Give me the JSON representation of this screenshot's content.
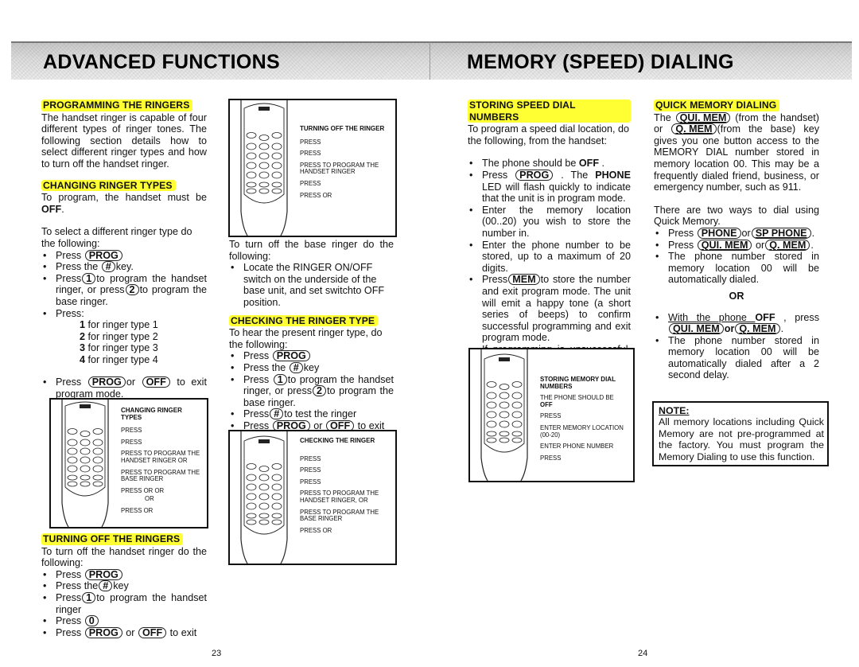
{
  "left_page": {
    "banner_title": "ADVANCED FUNCTIONS",
    "page_number": "23",
    "programming": {
      "heading": "PROGRAMMING THE RINGERS",
      "body": "The handset ringer is capable of four different types of ringer tones. The following section details how to select different ringer types and how to turn off the handset ringer."
    },
    "changing": {
      "heading": "CHANGING RINGER TYPES",
      "intro_pre": "To program, the handset must be ",
      "intro_bold": "OFF",
      "intro_post": ".",
      "select_text": "To select a different ringer type do the following:",
      "steps": {
        "s1_pre": "Press ",
        "s1_key": "PROG",
        "s2_pre": "Press the ",
        "s2_key": "#",
        "s2_post": "key.",
        "s3_pre": "Press",
        "s3_key": "1",
        "s3_mid": "to program the handset ringer, or press",
        "s3_key2": "2",
        "s3_post": "to program the base ringer.",
        "s4": "Press:",
        "s6_pre": "Press ",
        "s6_key": "PROG",
        "s6_mid": "or ",
        "s6_key2": "OFF",
        "s6_post": " to exit program mode."
      },
      "ringer_types": [
        {
          "num": "1",
          "label": " for ringer type 1"
        },
        {
          "num": "2",
          "label": " for ringer type 2"
        },
        {
          "num": "3",
          "label": " for ringer type 3"
        },
        {
          "num": "4",
          "label": " for ringer type 4"
        }
      ],
      "diagram": {
        "title": "CHANGING RINGER TYPES",
        "steps": [
          "PRESS",
          "PRESS",
          "PRESS  TO PROGRAM THE HANDSET RINGER OR",
          "PRESS  TO PROGRAM THE BASE RINGER",
          "PRESS  OR  OR",
          "OR",
          "PRESS  OR"
        ]
      }
    },
    "turning_off": {
      "heading": "TURNING OFF THE RINGERS",
      "intro": "To turn off the handset ringer do the following:",
      "s1_pre": "Press ",
      "s1_key": "PROG",
      "s2_pre": "Press the",
      "s2_key": "#",
      "s2_post": "key",
      "s3_pre": "Press",
      "s3_key": "1",
      "s3_post": "to program the handset ringer",
      "s4_pre": "Press ",
      "s4_key": "0",
      "s5_pre": "Press ",
      "s5_key": "PROG",
      "s5_mid": " or ",
      "s5_key2": "OFF",
      "s5_post": " to exit"
    }
  },
  "middle_column": {
    "diagram_turning_off": {
      "title": "TURNING OFF THE RINGER",
      "steps": [
        "PRESS",
        "PRESS",
        "PRESS  TO PROGRAM THE HANDSET RINGER",
        "PRESS",
        "PRESS  OR"
      ]
    },
    "base_ringer_intro": "To turn off the base ringer do the following:",
    "base_ringer_step": "Locate the RINGER ON/OFF switch on the underside of the base unit, and set switchto OFF position.",
    "checking": {
      "heading": "CHECKING THE RINGER TYPE",
      "intro": "To hear the present ringer type, do the following:",
      "s1_pre": "Press ",
      "s1_key": "PROG",
      "s2_pre": "Press the ",
      "s2_key": "#",
      "s2_post": "key",
      "s3_pre": "Press ",
      "s3_key": "1",
      "s3_mid": "to program the handset ringer, or press",
      "s3_key2": "2",
      "s3_post": "to program the base ringer.",
      "s4_pre": "Press",
      "s4_key": "#",
      "s4_post": "to test the ringer",
      "s5_pre": "Press ",
      "s5_key": "PROG",
      "s5_mid": " or ",
      "s5_key2": "OFF",
      "s5_post": " to exit"
    },
    "diagram_checking": {
      "title": "CHECKING THE RINGER",
      "steps": [
        "PRESS",
        "PRESS",
        "PRESS",
        "PRESS  TO PROGRAM THE HANDSET RINGER, OR",
        "PRESS  TO PROGRAM THE BASE RINGER",
        "PRESS  OR"
      ]
    }
  },
  "right_page": {
    "banner_title": "MEMORY (SPEED) DIALING",
    "page_number": "24",
    "storing": {
      "heading": "STORING SPEED DIAL NUMBERS",
      "intro": "To program a speed dial location, do the following, from the handset:",
      "s1_pre": "The phone should be ",
      "s1_bold": "OFF",
      "s1_post": " .",
      "s2_pre": "Press ",
      "s2_key": "PROG",
      "s2_mid": " . The ",
      "s2_bold": "PHONE",
      "s2_post": "  LED will flash quickly to indicate that the unit is in program mode.",
      "s3": "Enter the memory location (00..20) you wish to store the number in.",
      "s4": "Enter the phone number to be stored, up to a maximum of 20 digits.",
      "s5_pre": "Press",
      "s5_key": "MEM",
      "s5_post": "to store the number and exit program mode.  The unit will emit a happy tone (a short series of beeps) to confirm successful programming and exit program mode.",
      "s6": "If programming is unsuccessful, the unit will generate an error tone."
    },
    "diagram_storing": {
      "title": "STORING MEMORY DIAL NUMBERS",
      "steps": [
        "THE PHONE SHOULD BE",
        "OFF",
        "PRESS",
        "ENTER MEMORY LOCATION (00-20)",
        "ENTER PHONE NUMBER",
        "PRESS"
      ]
    },
    "quick": {
      "heading": "QUICK MEMORY DIALING",
      "p1_pre": "The ",
      "p1_key": "QUI. MEM",
      "p1_mid": " (from the handset) or ",
      "p1_key2": "Q. MEM",
      "p1_post": "(from the base) key gives you one button access to the MEMORY DIAL number stored in memory location 00. This may be a frequently dialed friend, business, or emergency number, such as 911.",
      "p2": "There are two ways to dial using Quick Memory.",
      "s1_pre": "Press ",
      "s1_key": "PHONE",
      "s1_mid": "or",
      "s1_key2": "SP PHONE",
      "s1_post": ".",
      "s2_pre": "Press ",
      "s2_key": "QUI. MEM",
      "s2_mid": " or",
      "s2_key2": "Q. MEM",
      "s2_post": ".",
      "s3": "The phone number stored in memory location 00 will be automatically dialed.",
      "or_label": "OR",
      "s4_pre": "With the phone ",
      "s4_bold": "OFF",
      "s4_mid": " , press ",
      "s4_key": "QUI. MEM",
      "s4_or": "or",
      "s4_key2": "Q. MEM",
      "s4_post": ".",
      "s5": "The phone number stored in memory location 00 will be automatically dialed after a 2 second delay."
    },
    "note": {
      "title": "NOTE:",
      "body": "All memory locations including Quick Memory are not pre-programmed at the factory. You must program the Memory Dialing to use this function."
    }
  },
  "colors": {
    "highlight": "#ffff33",
    "text": "#111111",
    "banner_gray": "#d4d4d4"
  }
}
